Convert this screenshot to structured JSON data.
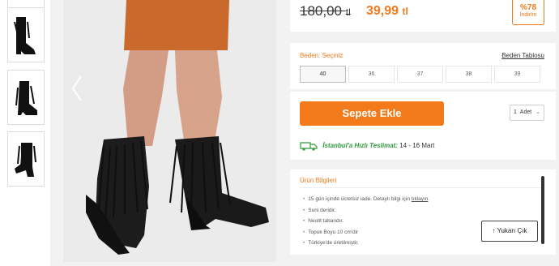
{
  "price": {
    "old_value": "180,00",
    "old_currency": "tl",
    "new_value": "39,99",
    "new_currency": "tl",
    "discount_pct": "%78",
    "discount_label": "İndirim"
  },
  "size": {
    "label": "Beden: Seçiniz",
    "table_link": "Beden Tablosu",
    "options": [
      "40",
      "36",
      "37",
      "38",
      "39"
    ],
    "selected": "40"
  },
  "cart": {
    "add_label": "Sepete Ekle",
    "quantity_value": "1",
    "quantity_unit": "Adet"
  },
  "delivery": {
    "city_label": "İstanbul'a Hızlı Teslimat:",
    "date_range": "14 - 16 Mart"
  },
  "product_info": {
    "title": "Ürün Bilgileri",
    "items": [
      "15 gün içinde ücretsiz iade. Detaylı bilgi için ",
      "Suni deridir.",
      "Neolit tabandır.",
      "Topuk Boyu 10 cm'dir",
      "Türkiye'de üretilmiştir."
    ],
    "link_text": "tıklayın",
    "link_suffix": "."
  },
  "scroll_top_label": "Yukarı Çık",
  "icons": {
    "gallery_prev": "chevron-left-icon",
    "gallery_next": "chevron-right-icon",
    "delivery": "truck-icon",
    "quantity": "chevron-down-icon",
    "scroll_top": "arrow-up-icon"
  },
  "colors": {
    "accent": "#f27a1a",
    "delivery_green": "#2e9a3c"
  }
}
